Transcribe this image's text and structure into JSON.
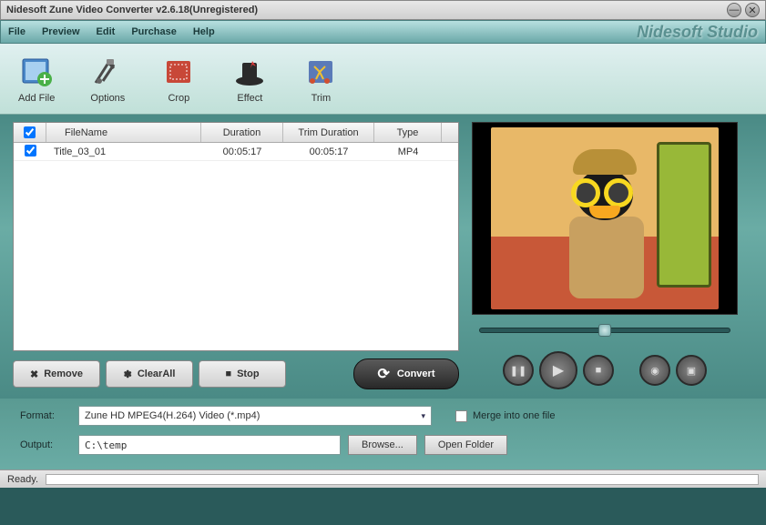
{
  "window": {
    "title": "Nidesoft Zune Video Converter v2.6.18(Unregistered)"
  },
  "brand": "Nidesoft Studio",
  "menu": {
    "file": "File",
    "preview": "Preview",
    "edit": "Edit",
    "purchase": "Purchase",
    "help": "Help"
  },
  "toolbar": {
    "add_file": "Add File",
    "options": "Options",
    "crop": "Crop",
    "effect": "Effect",
    "trim": "Trim"
  },
  "table": {
    "headers": {
      "checkbox": "",
      "filename": "FileName",
      "duration": "Duration",
      "trim_duration": "Trim Duration",
      "type": "Type"
    },
    "rows": [
      {
        "checked": true,
        "filename": "Title_03_01",
        "duration": "00:05:17",
        "trim_duration": "00:05:17",
        "type": "MP4"
      }
    ]
  },
  "actions": {
    "remove": "Remove",
    "clear_all": "ClearAll",
    "stop": "Stop",
    "convert": "Convert"
  },
  "format": {
    "label": "Format:",
    "value": "Zune HD MPEG4(H.264) Video (*.mp4)",
    "merge_label": "Merge into one file",
    "merge_checked": false
  },
  "output": {
    "label": "Output:",
    "value": "C:\\temp",
    "browse": "Browse...",
    "open_folder": "Open Folder"
  },
  "status": {
    "text": "Ready."
  },
  "icons": {
    "minimize": "—",
    "close": "✕",
    "remove": "✖",
    "clear": "✽",
    "stop": "■",
    "refresh": "⟳",
    "pause": "❚❚",
    "play": "▶",
    "stop2": "■",
    "snapshot": "📷",
    "folder": "📁",
    "chevron": "▾"
  }
}
